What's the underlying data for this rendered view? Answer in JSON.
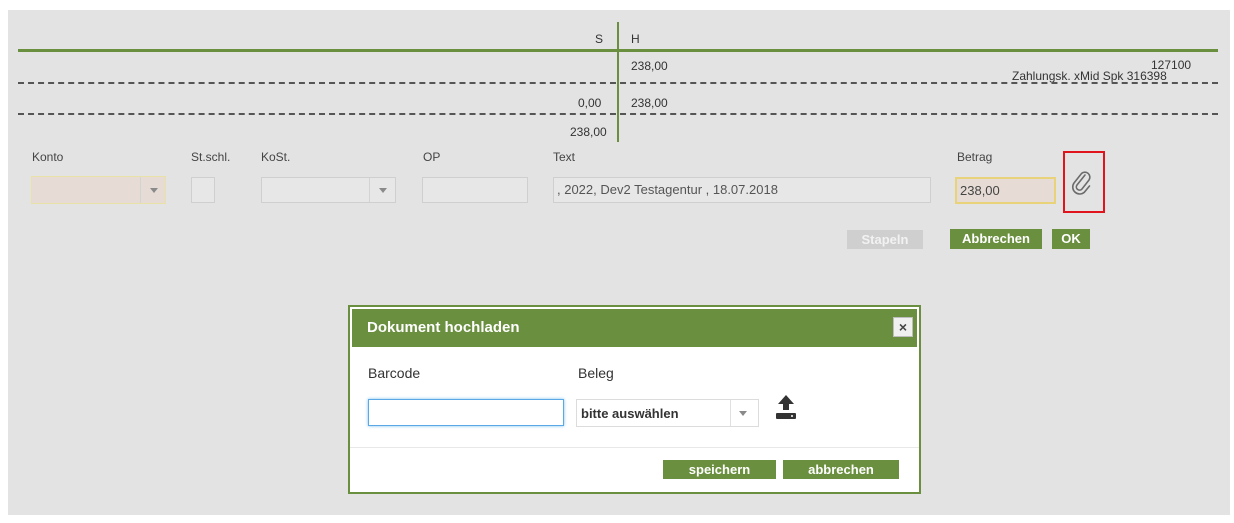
{
  "ledger": {
    "col_s": "S",
    "col_h": "H",
    "row1_h": "238,00",
    "account_number": "127100",
    "account_name": "Zahlungsk. xMid Spk 316398",
    "row2_s": "0,00",
    "row2_h": "238,00",
    "row3_s": "238,00"
  },
  "form": {
    "konto_label": "Konto",
    "stschl_label": "St.schl.",
    "kost_label": "KoSt.",
    "op_label": "OP",
    "text_label": "Text",
    "betrag_label": "Betrag",
    "text_value": ", 2022, Dev2 Testagentur , 18.07.2018",
    "betrag_value": "238,00"
  },
  "buttons": {
    "stapeln": "Stapeln",
    "abbrechen": "Abbrechen",
    "ok": "OK"
  },
  "icons": {
    "attach": "paperclip-icon",
    "upload": "upload-icon",
    "close": "close-icon"
  },
  "colors": {
    "accent_green": "#6a8f3f",
    "highlight_red": "#e0141c"
  },
  "modal": {
    "title": "Dokument hochladen",
    "barcode_label": "Barcode",
    "barcode_value": "",
    "beleg_label": "Beleg",
    "beleg_selected": "bitte auswählen",
    "save_label": "speichern",
    "cancel_label": "abbrechen"
  }
}
